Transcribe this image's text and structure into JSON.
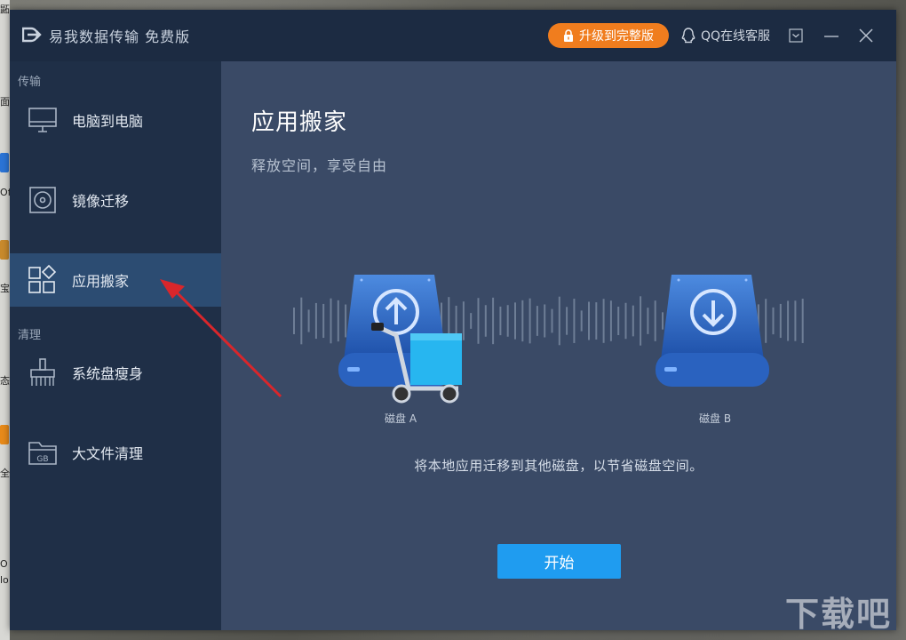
{
  "desktop": {
    "side_chars": [
      "鼫",
      "面",
      "Of",
      "宝",
      "态",
      "全",
      "O",
      "lo"
    ]
  },
  "window": {
    "title": "易我数据传输 免费版",
    "upgrade_label": "升级到完整版",
    "support_label": "QQ在线客服"
  },
  "sidebar": {
    "section_transfer": "传输",
    "section_clean": "清理",
    "items": [
      {
        "label": "电脑到电脑",
        "icon": "monitor-icon"
      },
      {
        "label": "镜像迁移",
        "icon": "disc-image-icon"
      },
      {
        "label": "应用搬家",
        "icon": "apps-grid-icon",
        "active": true
      },
      {
        "label": "系统盘瘦身",
        "icon": "broom-icon"
      },
      {
        "label": "大文件清理",
        "icon": "gb-folder-icon"
      }
    ]
  },
  "main": {
    "title": "应用搬家",
    "subtitle": "释放空间，享受自由",
    "disk_a": "磁盘 A",
    "disk_b": "磁盘 B",
    "description": "将本地应用迁移到其他磁盘，以节省磁盘空间。",
    "start_label": "开始"
  },
  "watermark": "下载吧",
  "colors": {
    "accent_orange": "#f07d1e",
    "start_blue": "#1f9cf0",
    "sidebar_active": "#2c4c72",
    "annotation_arrow": "#d9262b"
  }
}
